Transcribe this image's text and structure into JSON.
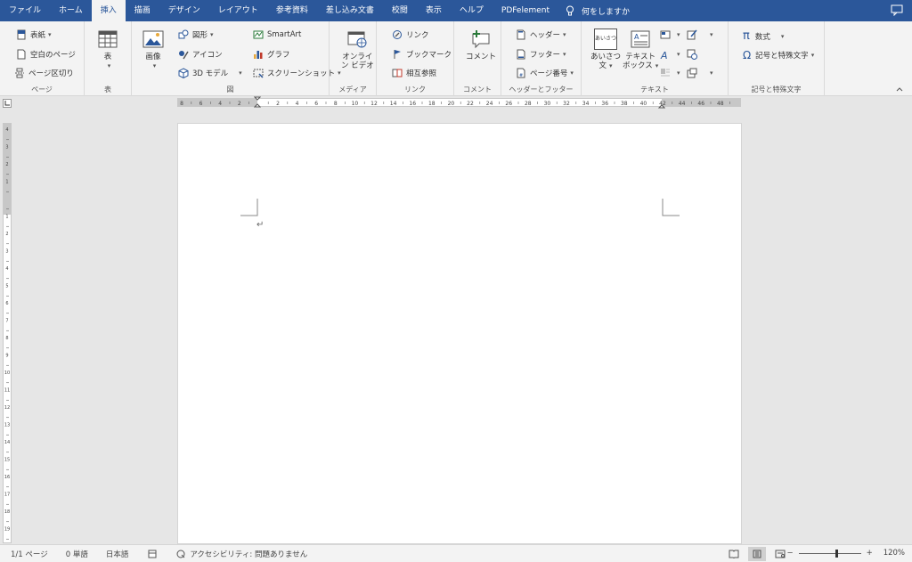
{
  "tabs": [
    {
      "label": "ファイル"
    },
    {
      "label": "ホーム"
    },
    {
      "label": "挿入",
      "active": true
    },
    {
      "label": "描画"
    },
    {
      "label": "デザイン"
    },
    {
      "label": "レイアウト"
    },
    {
      "label": "参考資料"
    },
    {
      "label": "差し込み文書"
    },
    {
      "label": "校閲"
    },
    {
      "label": "表示"
    },
    {
      "label": "ヘルプ"
    },
    {
      "label": "PDFelement"
    }
  ],
  "tell_me": "何をしますか",
  "ribbon": {
    "page": {
      "label": "ページ",
      "cover": "表紙",
      "blank": "空白のページ",
      "break": "ページ区切り"
    },
    "table": {
      "label": "表",
      "table_btn": "表"
    },
    "illustrations": {
      "label": "図",
      "image": "画像",
      "shapes": "図形",
      "icons": "アイコン",
      "model3d": "3D モデル",
      "smartart": "SmartArt",
      "chart": "グラフ",
      "screenshot": "スクリーンショット"
    },
    "media": {
      "label": "メディア",
      "online_video_l1": "オンライ",
      "online_video_l2": "ン ビデオ"
    },
    "links": {
      "label": "リンク",
      "link": "リンク",
      "bookmark": "ブックマーク",
      "crossref": "相互参照"
    },
    "comments": {
      "label": "コメント",
      "comment": "コメント"
    },
    "header_footer": {
      "label": "ヘッダーとフッター",
      "header": "ヘッダー",
      "footer": "フッター",
      "page_number": "ページ番号"
    },
    "text": {
      "label": "テキスト",
      "greeting_l1": "あいさつ",
      "greeting_l2": "文",
      "greeting_icon_text": "あいさつ",
      "textbox_l1": "テキスト",
      "textbox_l2": "ボックス"
    },
    "symbols": {
      "label": "記号と特殊文字",
      "equation": "数式",
      "symbol": "記号と特殊文字"
    }
  },
  "ruler": {
    "h_labels": [
      "8",
      "6",
      "4",
      "2",
      "",
      "2",
      "4",
      "6",
      "8",
      "10",
      "12",
      "14",
      "16",
      "18",
      "20",
      "22",
      "24",
      "26",
      "28",
      "30",
      "32",
      "34",
      "36",
      "38",
      "40",
      "42",
      "44",
      "46",
      "48"
    ],
    "v_labels": [
      "4",
      "3",
      "2",
      "1",
      "",
      "1",
      "2",
      "3",
      "4",
      "5",
      "6",
      "7",
      "8",
      "9",
      "10",
      "11",
      "12",
      "13",
      "14",
      "15",
      "16",
      "17",
      "18",
      "19"
    ]
  },
  "document": {
    "paragraph_mark": "↵"
  },
  "status": {
    "page": "1/1 ページ",
    "words": "0 単語",
    "language": "日本語",
    "accessibility": "アクセシビリティ: 問題ありません",
    "zoom": "120%",
    "zoom_minus": "−",
    "zoom_plus": "+"
  },
  "colors": {
    "accent": "#2b579a",
    "ribbon_bg": "#f3f3f3",
    "canvas_bg": "#e6e6e6"
  }
}
